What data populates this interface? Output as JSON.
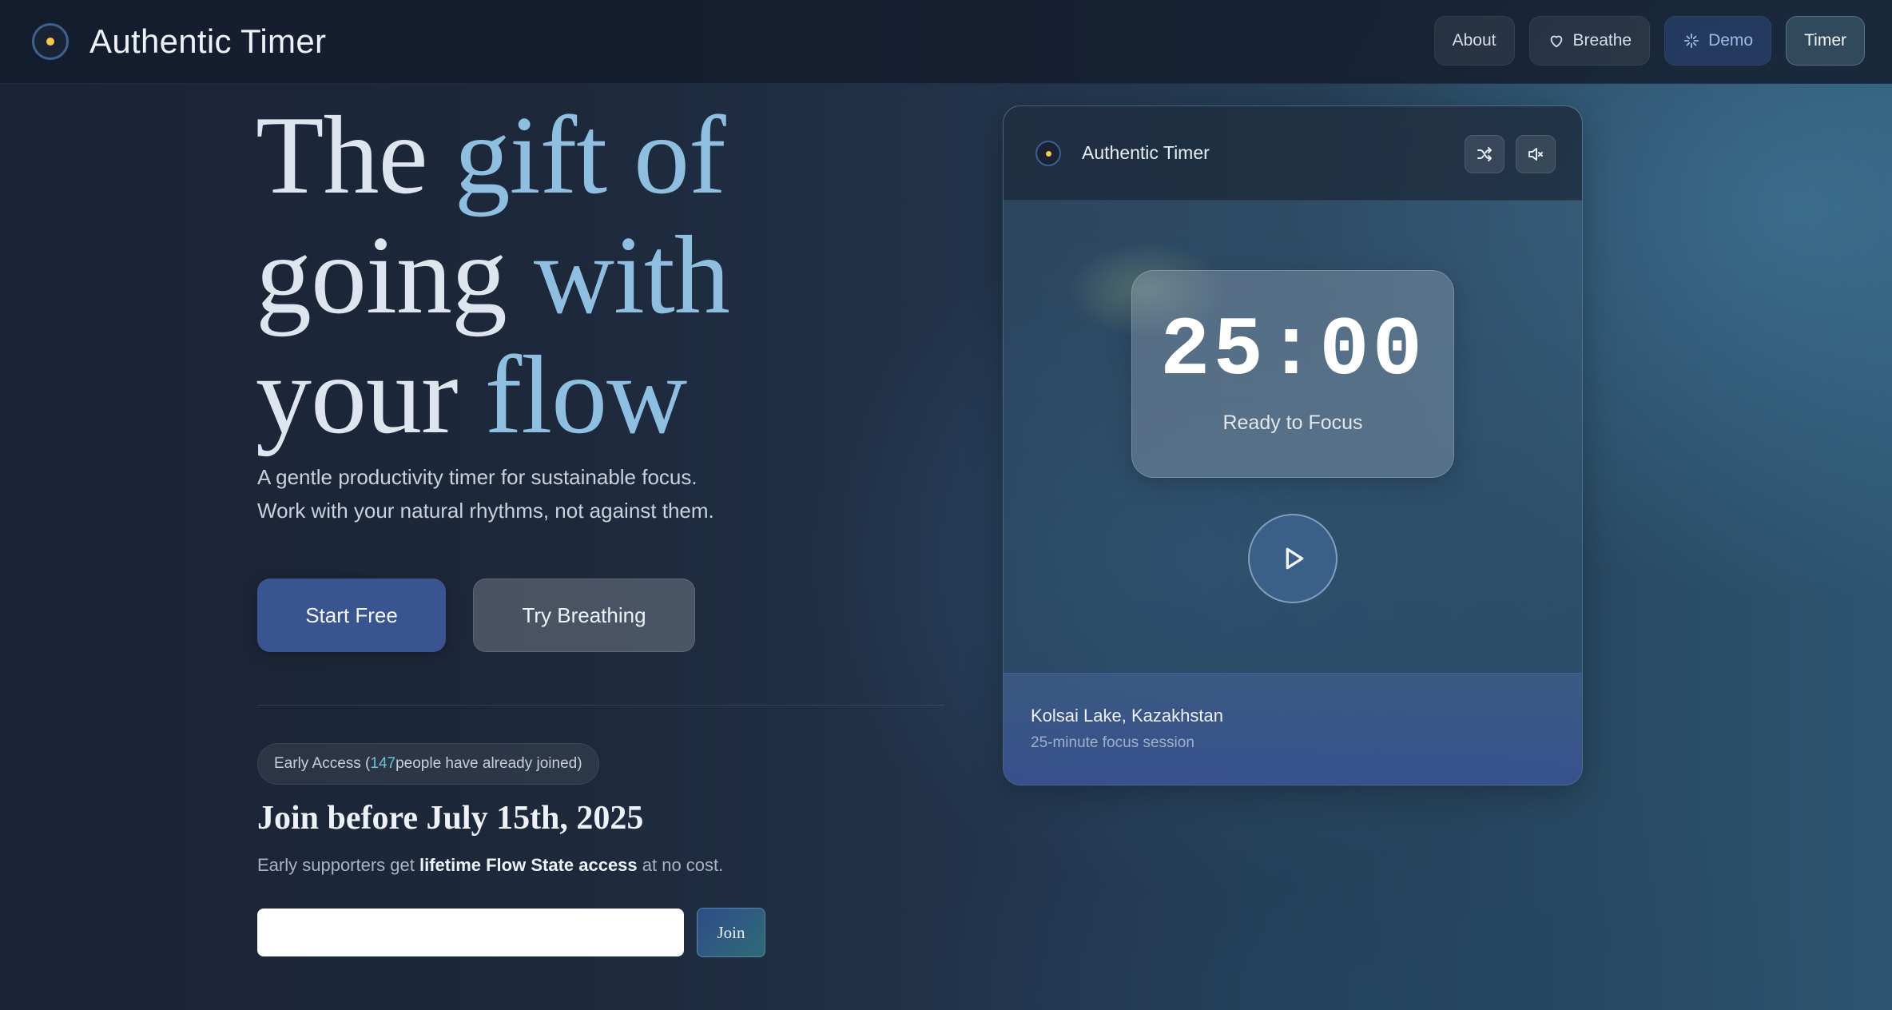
{
  "app": {
    "name": "Authentic Timer"
  },
  "nav": {
    "about": "About",
    "breathe": "Breathe",
    "demo": "Demo",
    "timer": "Timer"
  },
  "hero": {
    "line1_a": "The ",
    "line1_b": "gift of",
    "line2_a": "going ",
    "line2_b": "with",
    "line3_a": "your ",
    "line3_b": "flow",
    "subtitle_1": "A gentle productivity timer for sustainable focus.",
    "subtitle_2": "Work with your natural rhythms, not against them.",
    "primary_cta": "Start Free",
    "secondary_cta": "Try Breathing"
  },
  "early_access": {
    "prefix": "Early Access (",
    "count": "147",
    "suffix": " people have already joined)",
    "title": "Join before July 15th, 2025",
    "sub_prefix": "Early supporters get ",
    "sub_bold": "lifetime Flow State access",
    "sub_suffix": " at no cost.",
    "email_placeholder": "",
    "join_label": "Join"
  },
  "timer_card": {
    "title": "Authentic Timer",
    "time": "25:00",
    "status": "Ready to Focus",
    "location": "Kolsai Lake, Kazakhstan",
    "session": "25-minute focus session"
  },
  "colors": {
    "accent_text": "#8fbfe0",
    "primary_button": "#3a5490",
    "logo_dot": "#f2c94c",
    "count_highlight": "#6fc3d3"
  },
  "icons": [
    "logo-icon",
    "heart-icon",
    "sparkle-icon",
    "shuffle-icon",
    "mute-icon",
    "play-icon"
  ]
}
